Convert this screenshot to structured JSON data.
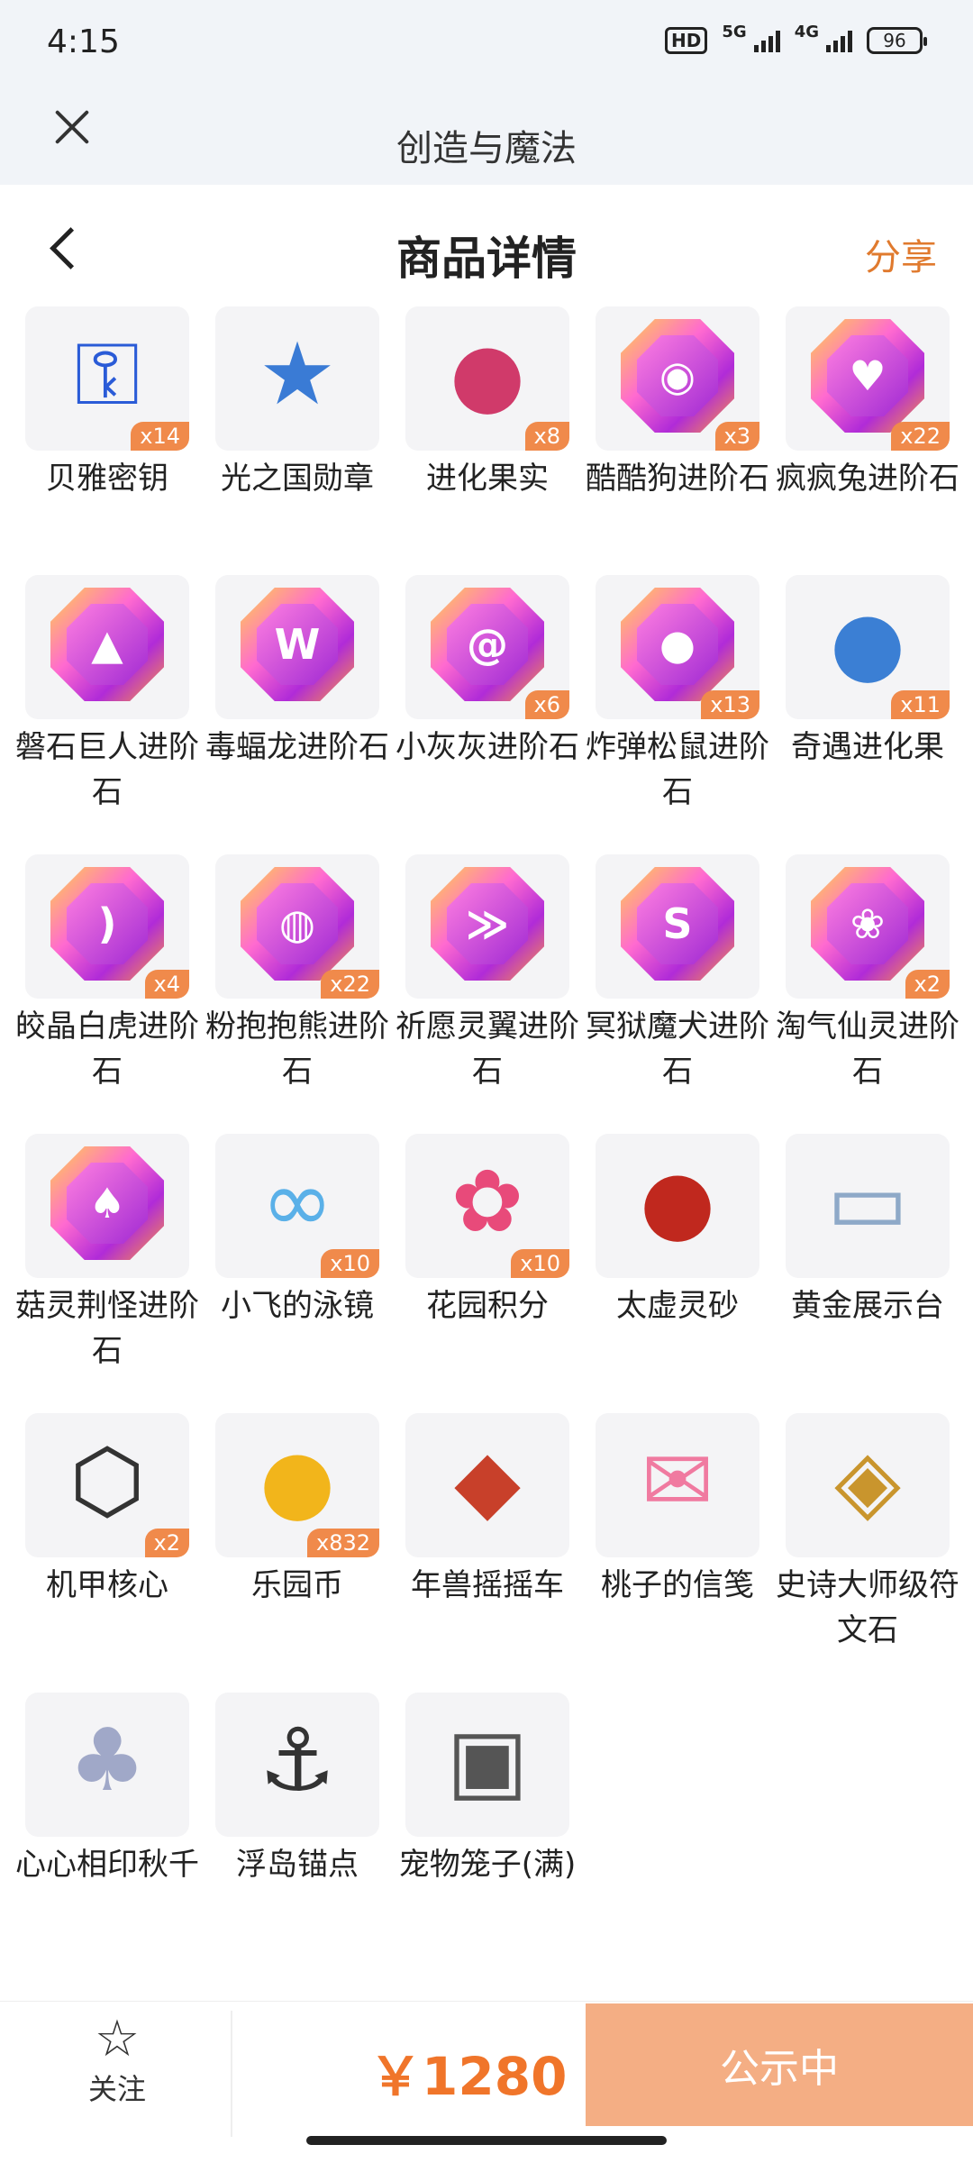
{
  "status_bar": {
    "time": "4:15",
    "hd": "HD",
    "net1": "5G",
    "net2": "4G",
    "battery": "96"
  },
  "app": {
    "title": "创造与魔法"
  },
  "nav": {
    "title": "商品详情",
    "share": "分享"
  },
  "items": [
    {
      "name": "贝雅密钥",
      "count": "x14",
      "icon": "key-card-icon"
    },
    {
      "name": "光之国勋章",
      "count": "",
      "icon": "star-medal-icon"
    },
    {
      "name": "进化果实",
      "count": "x8",
      "icon": "berry-fruit-icon"
    },
    {
      "name": "酷酷狗进阶石",
      "count": "x3",
      "icon": "gem-goggles-icon"
    },
    {
      "name": "疯疯兔进阶石",
      "count": "x22",
      "icon": "gem-carrot-icon"
    },
    {
      "name": "磐石巨人进阶石",
      "count": "",
      "icon": "gem-rock-icon"
    },
    {
      "name": "毒蝠龙进阶石",
      "count": "",
      "icon": "gem-bat-icon"
    },
    {
      "name": "小灰灰进阶石",
      "count": "x6",
      "icon": "gem-lollipop-icon"
    },
    {
      "name": "炸弹松鼠进阶石",
      "count": "x13",
      "icon": "gem-acorn-icon"
    },
    {
      "name": "奇遇进化果",
      "count": "x11",
      "icon": "blue-berry-icon"
    },
    {
      "name": "皎晶白虎进阶石",
      "count": "x4",
      "icon": "gem-claw-icon"
    },
    {
      "name": "粉抱抱熊进阶石",
      "count": "x22",
      "icon": "gem-egg-icon"
    },
    {
      "name": "祈愿灵翼进阶石",
      "count": "",
      "icon": "gem-wing-icon"
    },
    {
      "name": "冥狱魔犬进阶石",
      "count": "",
      "icon": "gem-flame-icon"
    },
    {
      "name": "淘气仙灵进阶石",
      "count": "x2",
      "icon": "gem-fairy-icon"
    },
    {
      "name": "菇灵荆怪进阶石",
      "count": "",
      "icon": "gem-mushroom-icon"
    },
    {
      "name": "小飞的泳镜",
      "count": "x10",
      "icon": "goggles-icon"
    },
    {
      "name": "花园积分",
      "count": "x10",
      "icon": "flower-icon"
    },
    {
      "name": "太虚灵砂",
      "count": "",
      "icon": "red-button-icon"
    },
    {
      "name": "黄金展示台",
      "count": "",
      "icon": "display-platform-icon"
    },
    {
      "name": "机甲核心",
      "count": "x2",
      "icon": "mech-core-icon"
    },
    {
      "name": "乐园币",
      "count": "x832",
      "icon": "gold-coin-icon"
    },
    {
      "name": "年兽摇摇车",
      "count": "",
      "icon": "beast-car-icon"
    },
    {
      "name": "桃子的信笺",
      "count": "",
      "icon": "pink-envelope-icon"
    },
    {
      "name": "史诗大师级符文石",
      "count": "",
      "icon": "rune-stone-icon"
    },
    {
      "name": "心心相印秋千",
      "count": "",
      "icon": "swing-icon"
    },
    {
      "name": "浮岛锚点",
      "count": "",
      "icon": "anchor-icon"
    },
    {
      "name": "宠物笼子(满)",
      "count": "",
      "icon": "pet-cage-icon"
    }
  ],
  "bottom": {
    "follow_label": "关注",
    "price": "￥1280",
    "status": "公示中"
  },
  "colors": {
    "accent": "#f0752a",
    "share": "#e07a2e",
    "status_button": "#f4ae84",
    "badge": "#f08a4b"
  }
}
